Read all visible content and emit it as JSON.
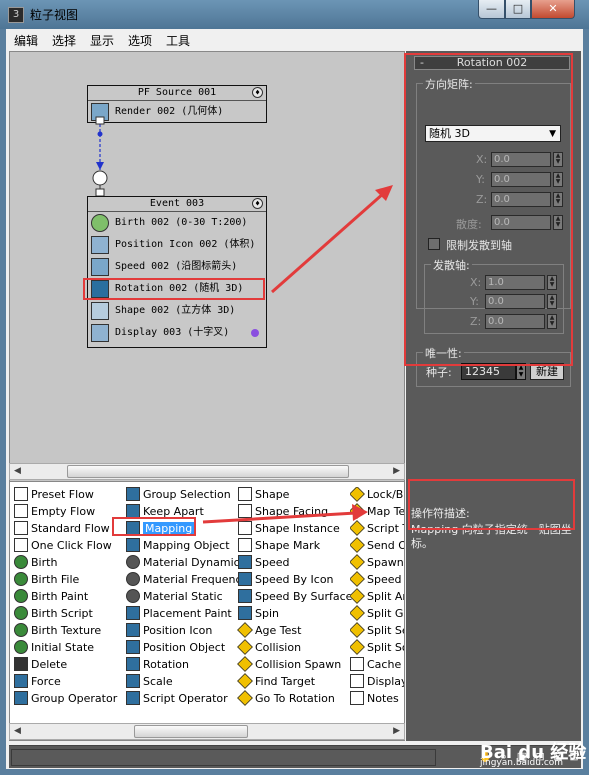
{
  "window": {
    "title": "粒子视图",
    "icon": "3ds-max-icon",
    "min": "—",
    "max": "□",
    "close": "✕"
  },
  "menu": [
    "编辑",
    "选择",
    "显示",
    "选项",
    "工具"
  ],
  "graph": {
    "source": {
      "title": "PF Source 001",
      "rows": [
        {
          "label": "Render 002 (几何体)",
          "icon": "render-icon"
        }
      ]
    },
    "event": {
      "title": "Event 003",
      "rows": [
        {
          "label": "Birth 002 (0-30 T:200)",
          "icon": "birth-icon"
        },
        {
          "label": "Position Icon 002 (体积)",
          "icon": "position-icon"
        },
        {
          "label": "Speed 002 (沿图标箭头)",
          "icon": "speed-icon"
        },
        {
          "label": "Rotation 002 (随机 3D)",
          "icon": "rotation-icon"
        },
        {
          "label": "Shape 002 (立方体 3D)",
          "icon": "shape-icon"
        },
        {
          "label": "Display 003 (十字叉)",
          "icon": "display-icon"
        }
      ]
    }
  },
  "depot": {
    "col1": [
      "Preset Flow",
      "Empty Flow",
      "Standard Flow",
      "One Click Flow",
      "Birth",
      "Birth File",
      "Birth Paint",
      "Birth Script",
      "Birth Texture",
      "Initial State",
      "Delete",
      "Force",
      "Group Operator"
    ],
    "col2": [
      "Group Selection",
      "Keep Apart",
      "Mapping",
      "Mapping Object",
      "Material Dynamic",
      "Material Frequency",
      "Material Static",
      "Placement Paint",
      "Position Icon",
      "Position Object",
      "Rotation",
      "Scale",
      "Script Operator"
    ],
    "col3": [
      "Shape",
      "Shape Facing",
      "Shape Instance",
      "Shape Mark",
      "Speed",
      "Speed By Icon",
      "Speed By Surface",
      "Spin",
      "Age Test",
      "Collision",
      "Collision Spawn",
      "Find Target",
      "Go To Rotation"
    ],
    "col4": [
      "Lock/Bo",
      "Map Te",
      "Script T",
      "Send Ou",
      "Spawn",
      "Speed T",
      "Split Am",
      "Split Gro",
      "Split Sel",
      "Split Sou",
      "Cache",
      "Display",
      "Notes"
    ]
  },
  "rollout": {
    "header": "Rotation 002",
    "orientation_group": "方向矩阵:",
    "orientation_value": "随机 3D",
    "x_label": "X:",
    "y_label": "Y:",
    "z_label": "Z:",
    "x": "0.0",
    "y": "0.0",
    "z": "0.0",
    "divergence_label": "散度:",
    "divergence": "0.0",
    "restrict_label": "限制发散到轴",
    "axis_group": "发散轴:",
    "ax": "1.0",
    "ay": "0.0",
    "az": "0.0",
    "unique_group": "唯一性:",
    "seed_label": "种子:",
    "seed": "12345",
    "new_button": "新建"
  },
  "description": {
    "title": "操作符描述:",
    "text": "Mapping 向粒子指定统一贴图坐标。"
  },
  "watermark": {
    "brand": "Bai du 经验",
    "url": "jingyan.baidu.com"
  }
}
